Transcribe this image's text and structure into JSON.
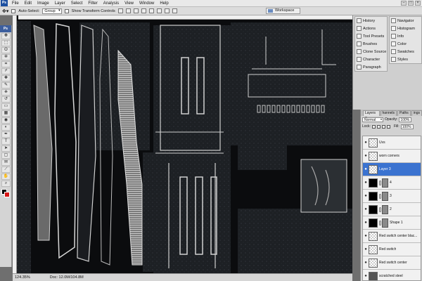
{
  "menubar": {
    "logo": "Ps",
    "items": [
      "File",
      "Edit",
      "Image",
      "Layer",
      "Select",
      "Filter",
      "Analysis",
      "View",
      "Window",
      "Help"
    ]
  },
  "options_bar": {
    "auto_select_label": "Auto-Select:",
    "auto_select_value": "Group",
    "show_transform_label": "Show Transform Controls",
    "workspace_label": "Workspace"
  },
  "tools": {
    "header": "Ps",
    "items": [
      "move-icon",
      "marquee-icon",
      "lasso-icon",
      "magic-wand-icon",
      "crop-icon",
      "slice-icon",
      "healing-icon",
      "brush-icon",
      "clone-stamp-icon",
      "history-brush-icon",
      "eraser-icon",
      "gradient-icon",
      "blur-icon",
      "dodge-icon",
      "pen-icon",
      "type-icon",
      "path-select-icon",
      "shape-icon",
      "notes-icon",
      "eyedropper-icon",
      "hand-icon",
      "zoom-icon"
    ],
    "glyphs": [
      "✥",
      "⬚",
      "ʘ",
      "✲",
      "⌗",
      "⌿",
      "✚",
      "✎",
      "⎈",
      "↺",
      "▭",
      "▦",
      "◉",
      "◐",
      "✒",
      "T",
      "➤",
      "▢",
      "✉",
      "⟋",
      "✋",
      "⌕"
    ],
    "foreground_color": "#000000",
    "background_color": "#d51414"
  },
  "status": {
    "zoom": "124.35%",
    "doc": "Doc: 12.0M/104.8M"
  },
  "dock": {
    "col1": [
      {
        "label": "History",
        "icon": "history-icon"
      },
      {
        "label": "Actions",
        "icon": "actions-icon"
      },
      {
        "label": "Tool Presets",
        "icon": "tool-presets-icon"
      },
      {
        "label": "Brushes",
        "icon": "brushes-icon"
      },
      {
        "label": "Clone Source",
        "icon": "clone-source-icon"
      },
      {
        "label": "Character",
        "icon": "character-icon"
      },
      {
        "label": "Paragraph",
        "icon": "paragraph-icon"
      }
    ],
    "col2": [
      {
        "label": "Navigator",
        "icon": "navigator-icon"
      },
      {
        "label": "Histogram",
        "icon": "histogram-icon"
      },
      {
        "label": "Info",
        "icon": "info-icon"
      },
      {
        "label": "Color",
        "icon": "color-icon"
      },
      {
        "label": "Swatches",
        "icon": "swatches-icon"
      },
      {
        "label": "Styles",
        "icon": "styles-icon"
      }
    ]
  },
  "layers_panel": {
    "tabs": [
      "Layers ×",
      "hannels",
      "Paths",
      "ings"
    ],
    "blend_mode": "Normal",
    "opacity_label": "Opacity:",
    "opacity_value": "100%",
    "lock_label": "Lock:",
    "fill_label": "Fill:",
    "fill_value": "100%",
    "layers": [
      {
        "name": "Uvs",
        "thumb": "checker",
        "mask": false,
        "selected": false
      },
      {
        "name": "worn corners",
        "thumb": "checker",
        "mask": false,
        "selected": false
      },
      {
        "name": "Layer 3",
        "thumb": "checker",
        "mask": false,
        "selected": true
      },
      {
        "name": "4",
        "thumb": "black",
        "mask": true,
        "selected": false
      },
      {
        "name": "3",
        "thumb": "black",
        "mask": true,
        "selected": false
      },
      {
        "name": "2",
        "thumb": "black",
        "mask": true,
        "selected": false
      },
      {
        "name": "Shape 1",
        "thumb": "black",
        "mask": true,
        "selected": false
      },
      {
        "name": "Red switch center blac...",
        "thumb": "checker",
        "mask": false,
        "selected": false
      },
      {
        "name": "Red switch",
        "thumb": "checker",
        "mask": false,
        "selected": false
      },
      {
        "name": "Red switch center",
        "thumb": "checker",
        "mask": false,
        "selected": false
      },
      {
        "name": "scratched steel",
        "thumb": "grey",
        "mask": false,
        "selected": false
      }
    ]
  }
}
